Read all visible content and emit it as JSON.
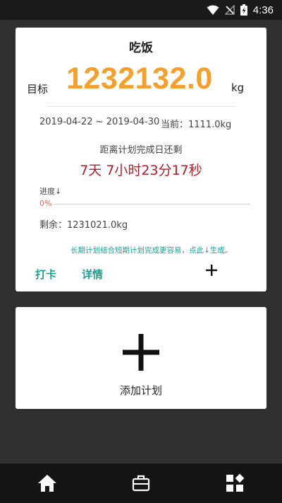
{
  "status_bar": {
    "time": "4:36"
  },
  "plan": {
    "title": "吃饭",
    "goal_label": "目标",
    "goal_value": "1232132.0",
    "goal_unit": "kg",
    "date_range": "2019-04-22 ~ 2019-04-30",
    "current": "当前：1111.0kg",
    "countdown_label": "距离计划完成日还剩",
    "countdown_value": "7天  7小时23分17秒",
    "progress_label": "进度↓",
    "progress_percent": "0%",
    "progress_value": 0,
    "remaining": "剩余：1231021.0kg",
    "hint": "长期计划结合短期计划完成更容易，点此↓生成。",
    "checkin_label": "打卡",
    "detail_label": "详情"
  },
  "add_plan": {
    "label": "添加计划"
  },
  "colors": {
    "accent_orange": "#f5a02c",
    "countdown_red": "#b11f2a",
    "teal": "#1ea18f",
    "progress": "#e8635a"
  },
  "icons": {
    "add_small": "plus-icon",
    "add_big": "plus-icon",
    "nav": [
      "home-icon",
      "briefcase-icon",
      "widgets-icon"
    ],
    "status": [
      "wifi-icon",
      "no-signal-icon",
      "battery-charging-icon"
    ]
  }
}
